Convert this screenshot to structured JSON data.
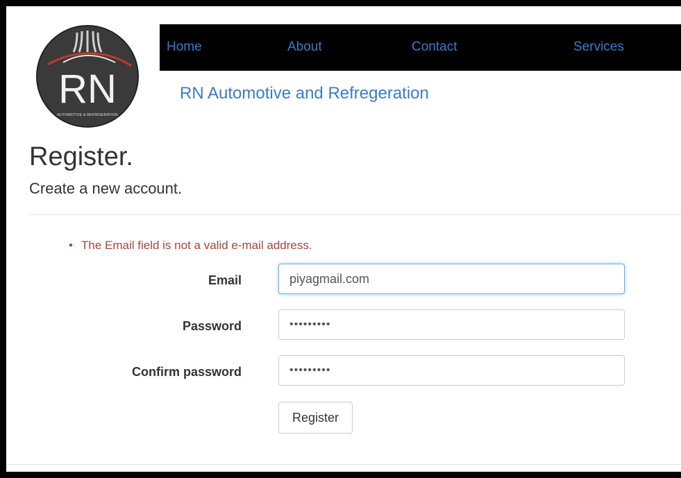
{
  "nav": {
    "items": [
      {
        "label": "Home"
      },
      {
        "label": "About"
      },
      {
        "label": "Contact"
      },
      {
        "label": "Services"
      }
    ]
  },
  "logo": {
    "text": "RN",
    "tagline": "AUTOMOTIVE & REFRIGERATION"
  },
  "brand": "RN Automotive and Refregeration",
  "page": {
    "title": "Register.",
    "subtitle": "Create a new account."
  },
  "errors": [
    "The Email field is not a valid e-mail address."
  ],
  "form": {
    "email_label": "Email",
    "email_value": "piyagmail.com",
    "password_label": "Password",
    "password_value": "•••••••••",
    "confirm_label": "Confirm password",
    "confirm_value": "•••••••••",
    "submit_label": "Register"
  },
  "colors": {
    "link": "#3a7bc8",
    "error": "#a94442",
    "focus": "#66afe9",
    "navbar": "#000000"
  }
}
